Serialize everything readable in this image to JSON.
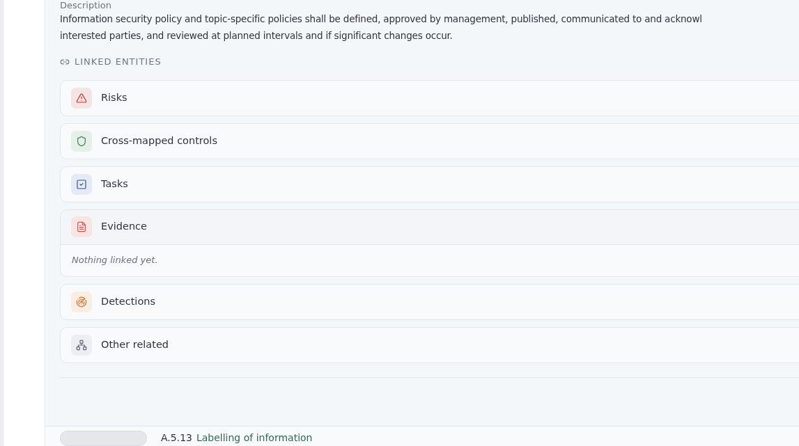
{
  "description": {
    "label": "Description",
    "text": "Information security policy and topic-specific policies shall be defined, approved by management, published, communicated to and acknowl",
    "text_line2": "interested parties, and reviewed at planned intervals and if significant changes occur."
  },
  "linked_entities": {
    "heading": "LINKED ENTITIES",
    "items": [
      {
        "kind": "risks",
        "label": "Risks",
        "expanded": false
      },
      {
        "kind": "controls",
        "label": "Cross-mapped controls",
        "expanded": false
      },
      {
        "kind": "tasks",
        "label": "Tasks",
        "expanded": false
      },
      {
        "kind": "evidence",
        "label": "Evidence",
        "expanded": true,
        "empty_text": "Nothing linked yet."
      },
      {
        "kind": "detections",
        "label": "Detections",
        "expanded": false
      },
      {
        "kind": "other",
        "label": "Other related",
        "expanded": false
      }
    ]
  },
  "next_control": {
    "code": "A.5.13",
    "title": "Labelling of information"
  }
}
